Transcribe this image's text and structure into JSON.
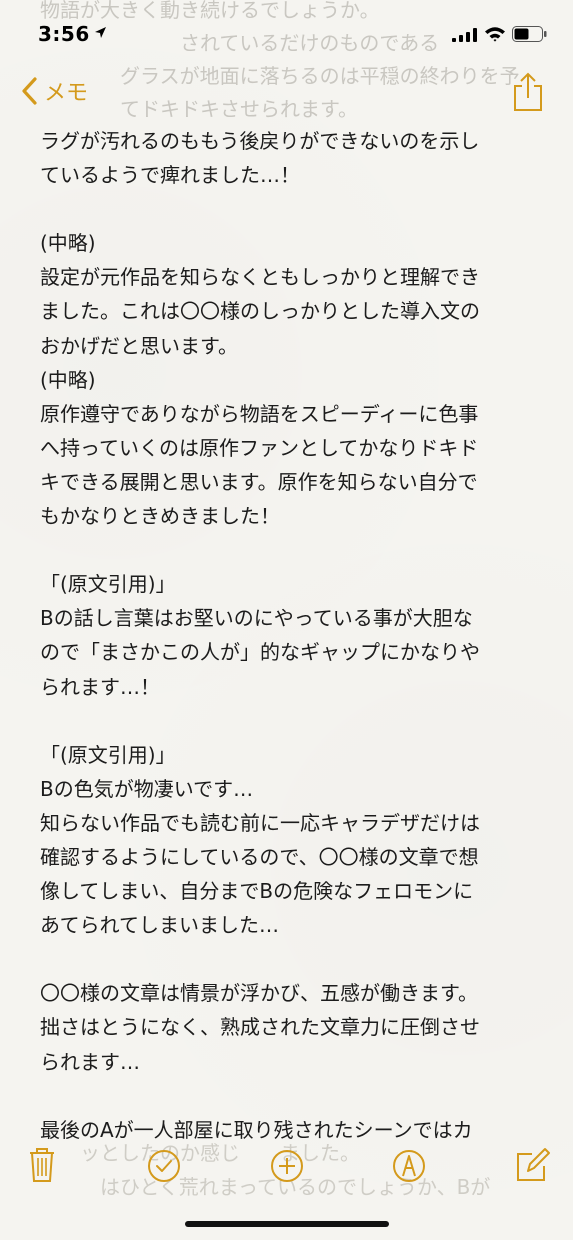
{
  "status_bar": {
    "time": "3:56"
  },
  "nav": {
    "back_label": "メモ"
  },
  "ghost_top_lines": [
    "物語が大きく動き続けるでしょうか。",
    "　　　　　　　されているだけのものである",
    "　　　　グラスが地面に落ちるのは平穏の終わりを予",
    "　　　　てドキドキさせられます。"
  ],
  "note": {
    "lines": [
      "ラグが汚れるのももう後戻りができないのを示し",
      "ているようで痺れました…！",
      "",
      "(中略)",
      "設定が元作品を知らなくともしっかりと理解でき",
      "ました。これは〇〇様のしっかりとした導入文の",
      "おかげだと思います。",
      "(中略)",
      "原作遵守でありながら物語をスピーディーに色事",
      "へ持っていくのは原作ファンとしてかなりドキド",
      "キできる展開と思います。原作を知らない自分で",
      "もかなりときめきました！",
      "",
      "「(原文引用)」",
      "Bの話し言葉はお堅いのにやっている事が大胆な",
      "ので「まさかこの人が」的なギャップにかなりや",
      "られます…！",
      "",
      "「(原文引用)」",
      "Bの色気が物凄いです…",
      "知らない作品でも読む前に一応キャラデザだけは",
      "確認するようにしているので、〇〇様の文章で想",
      "像してしまい、自分までBの危険なフェロモンに",
      "あてられてしまいました…",
      "",
      "〇〇様の文章は情景が浮かび、五感が働きます。",
      "拙さはとうになく、熟成された文章力に圧倒させ",
      "られます…",
      "",
      "最後のAが一人部屋に取り残されたシーンではカ"
    ]
  },
  "ghost_bottom_lines": [
    "　　ッとしたのか感じ　　ました。",
    "　　　はひとく荒れまっているのでしょうか、Bが"
  ],
  "colors": {
    "accent": "#d49a1c",
    "text": "#1c1c1c",
    "background": "#f5f4f0"
  },
  "toolbar": {
    "icons": [
      "trash-icon",
      "checklist-icon",
      "add-icon",
      "markup-icon",
      "compose-icon"
    ]
  }
}
